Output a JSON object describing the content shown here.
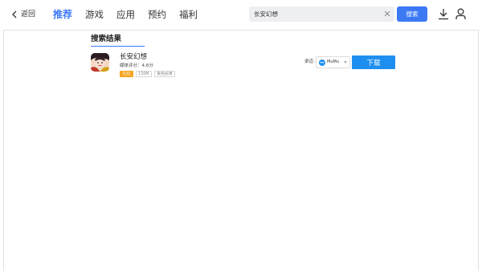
{
  "header": {
    "back_label": "返回",
    "nav_items": [
      {
        "label": "推荐",
        "active": true
      },
      {
        "label": "游戏",
        "active": false
      },
      {
        "label": "应用",
        "active": false
      },
      {
        "label": "预约",
        "active": false
      },
      {
        "label": "福利",
        "active": false
      }
    ],
    "search": {
      "value": "长安幻想",
      "button_label": "搜索"
    },
    "icons": {
      "back": "chevron-left-icon",
      "clear": "close-icon",
      "download": "download-icon",
      "user": "user-icon"
    }
  },
  "results": {
    "section_title": "搜索结果",
    "items": [
      {
        "name": "长安幻想",
        "rating_text": "媒体评分：4.6分",
        "tags": [
          "礼包",
          "130M",
          "角色扮演"
        ],
        "channel_label": "渠道:",
        "channel_name": "MuMu",
        "download_label": "下载"
      }
    ]
  },
  "colors": {
    "accent": "#3d79f5",
    "download_button": "#1e8ff0",
    "gift_tag": "#f5a623"
  }
}
